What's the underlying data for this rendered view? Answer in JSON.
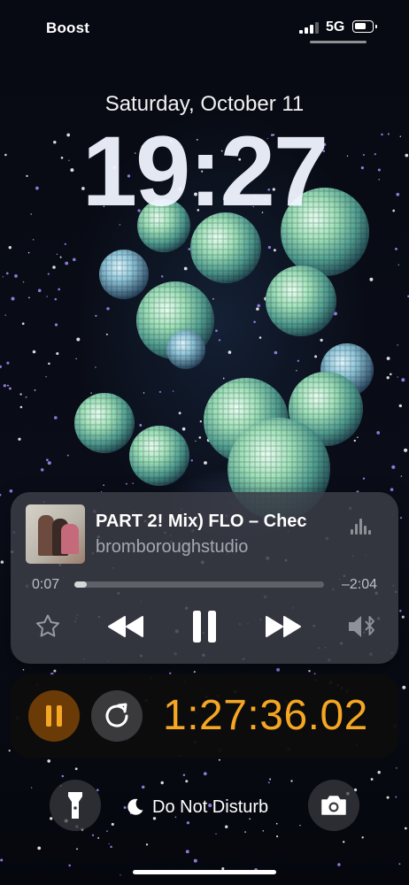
{
  "status_bar": {
    "carrier": "Boost",
    "network": "5G"
  },
  "lock_screen": {
    "date": "Saturday, October 11",
    "time": "19:27"
  },
  "now_playing": {
    "title": "PART 2! Mix)      FLO – Chec",
    "artist": "bromboroughstudio",
    "elapsed": "0:07",
    "remaining": "–2:04",
    "progress": 0.05,
    "controls": [
      "star-icon",
      "rewind-icon",
      "pause-icon",
      "fast-forward-icon",
      "airplay-bluetooth-icon"
    ]
  },
  "stopwatch": {
    "time": "1:27:36.02",
    "accent_color": "#f5a623"
  },
  "bottom_bar": {
    "dnd_label": "Do Not Disturb",
    "icons": [
      "flashlight-icon",
      "moon-icon",
      "camera-icon"
    ]
  }
}
